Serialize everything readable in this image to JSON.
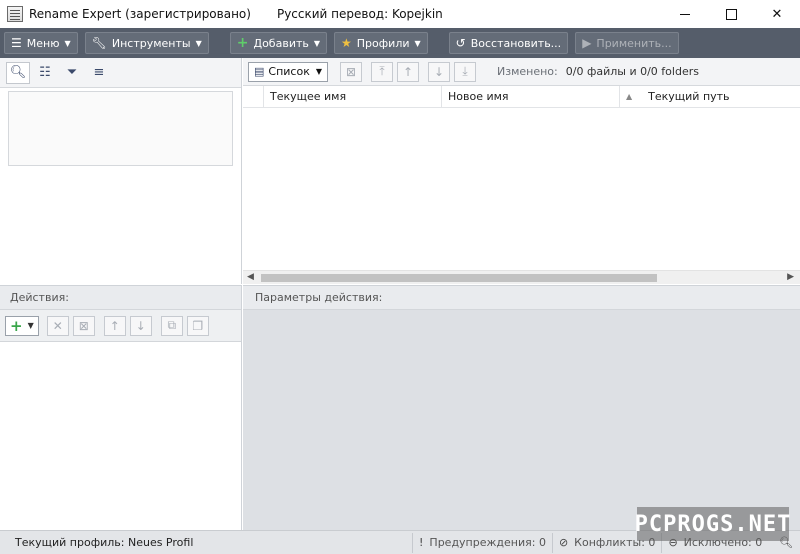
{
  "window": {
    "title": "Rename Expert (зарегистрировано)",
    "subtitle": "Русский перевод: Kopejkin",
    "close_glyph": "✕"
  },
  "toolbar": {
    "menu_label": "Меню",
    "tools_label": "Инструменты",
    "add_label": "Добавить",
    "profiles_label": "Профили",
    "restore_label": "Восстановить...",
    "apply_label": "Применить..."
  },
  "files": {
    "view_label": "Список",
    "changed_label": "Изменено:",
    "changed_value": "0/0 файлы и 0/0 folders",
    "columns": [
      "Текущее имя",
      "Новое имя",
      "Текущий путь"
    ]
  },
  "actions": {
    "header": "Действия:"
  },
  "params": {
    "header": "Параметры действия:"
  },
  "statusbar": {
    "profile": "Текущий профиль: Neues Profil",
    "warnings": "Предупреждения: 0",
    "conflicts": "Конфликты: 0",
    "excluded": "Исключено: 0"
  },
  "watermark": "PCPROGS.NET",
  "colors": {
    "toolbar_bg": "#555d6a",
    "params_bg": "#dde0e4",
    "statusbar_bg": "#e3e5e8"
  },
  "icons": [
    "app-icon",
    "menu-icon",
    "wrench-icon",
    "plus-icon",
    "star-icon",
    "undo-icon",
    "play-icon",
    "search-icon",
    "tree-icon",
    "filter-icon",
    "list-icon",
    "list-view-icon",
    "remove-icon",
    "move-top-icon",
    "move-up-icon",
    "move-down-icon",
    "move-bottom-icon",
    "delete-icon",
    "duplicate-icon",
    "copy-icon",
    "warning-icon",
    "conflict-icon",
    "excluded-icon"
  ]
}
